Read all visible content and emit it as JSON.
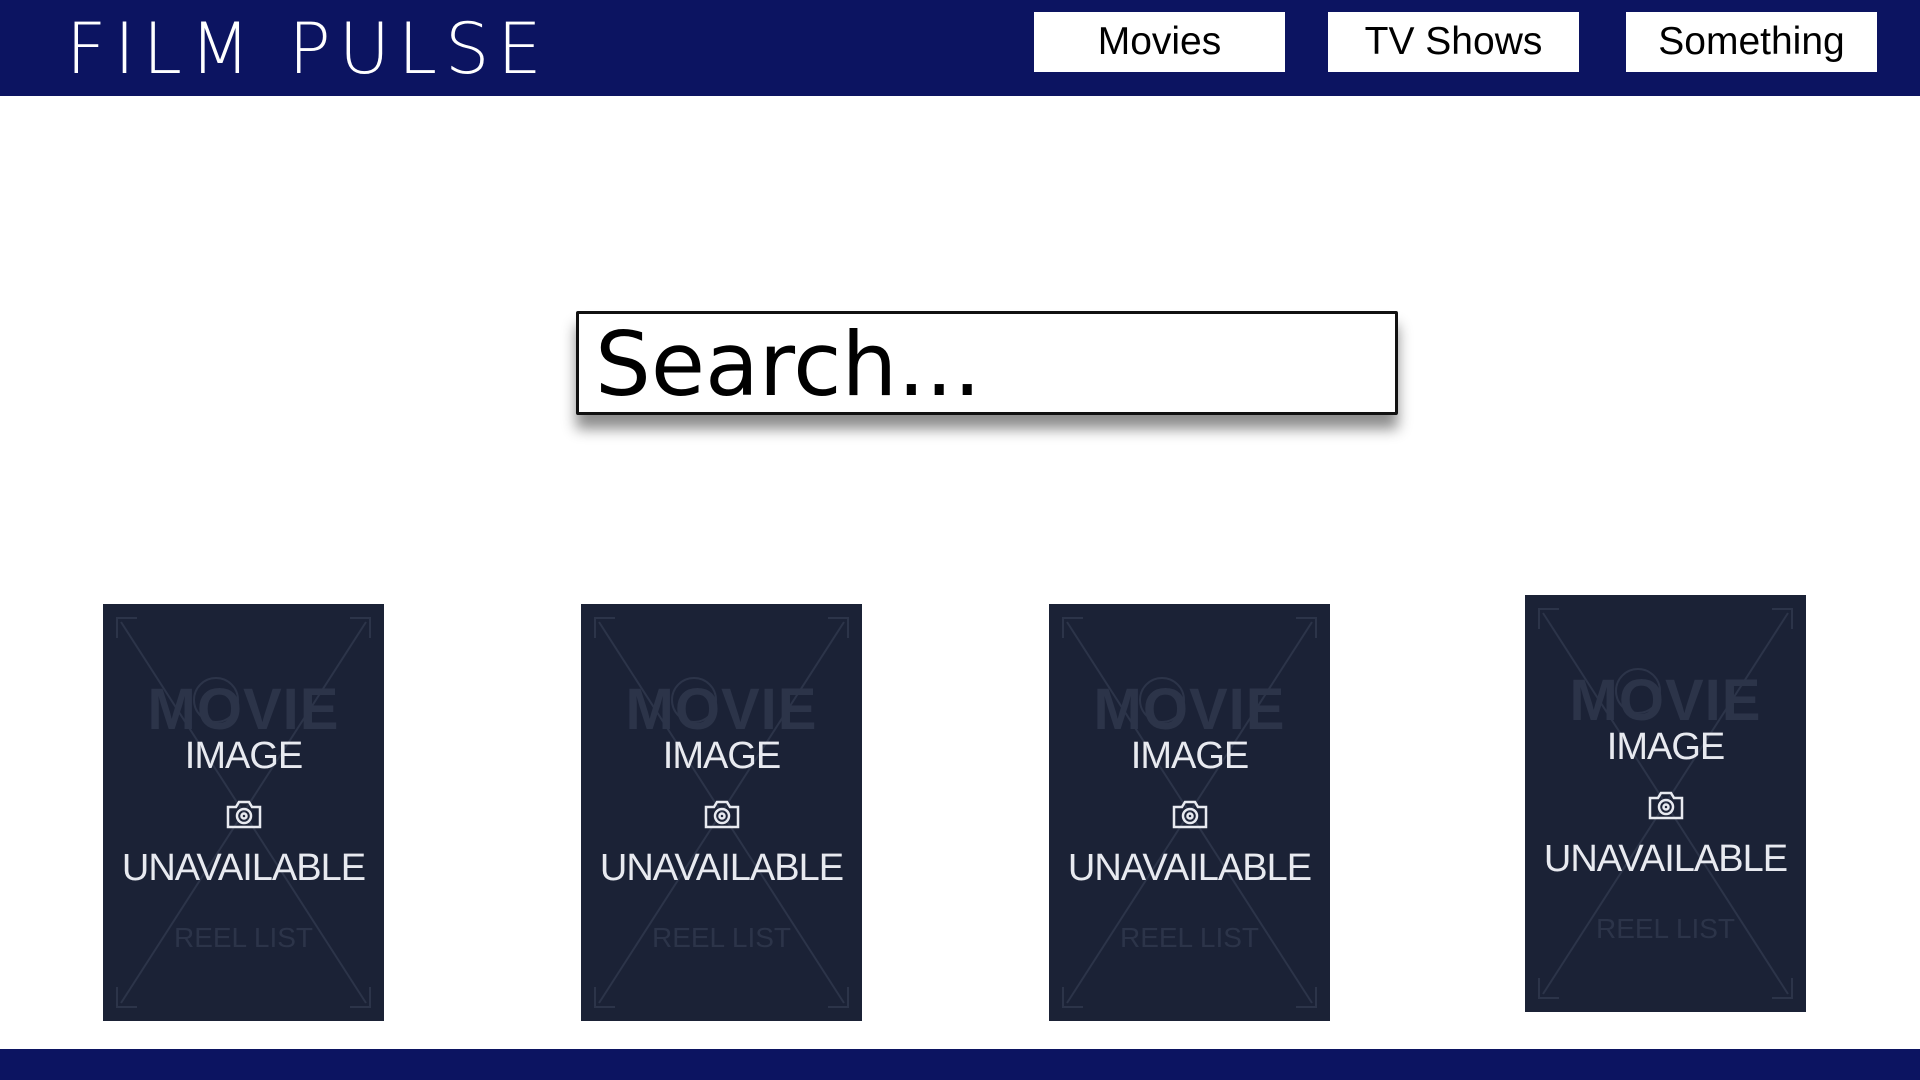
{
  "app": {
    "logo_text": "FILM PULSE"
  },
  "nav": {
    "items": [
      {
        "label": "Movies"
      },
      {
        "label": "TV Shows"
      },
      {
        "label": "Something"
      }
    ]
  },
  "search": {
    "placeholder": "Search..."
  },
  "posters": [
    {
      "line1": "IMAGE",
      "line2": "UNAVAILABLE",
      "icon": "camera-icon",
      "watermark": "MOVIE",
      "watermark_sub": "REEL LIST"
    },
    {
      "line1": "IMAGE",
      "line2": "UNAVAILABLE",
      "icon": "camera-icon",
      "watermark": "MOVIE",
      "watermark_sub": "REEL LIST"
    },
    {
      "line1": "IMAGE",
      "line2": "UNAVAILABLE",
      "icon": "camera-icon",
      "watermark": "MOVIE",
      "watermark_sub": "REEL LIST"
    },
    {
      "line1": "IMAGE",
      "line2": "UNAVAILABLE",
      "icon": "camera-icon",
      "watermark": "MOVIE",
      "watermark_sub": "REEL LIST"
    }
  ],
  "colors": {
    "header_bg": "#0c1461",
    "poster_bg": "#1b2236",
    "nav_button_bg": "#ffffff"
  }
}
